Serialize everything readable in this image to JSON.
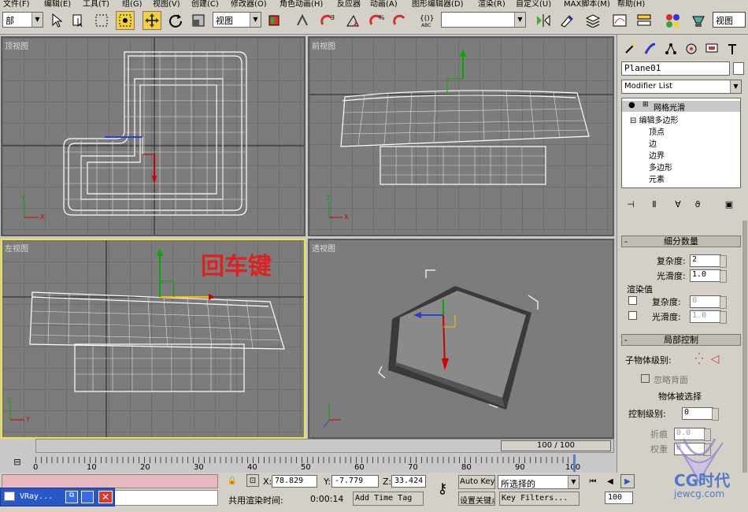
{
  "menu": {
    "items": [
      "文件(F)",
      "编辑(E)",
      "工具(T)",
      "组(G)",
      "视图(V)",
      "创建(C)",
      "修改器(O)",
      "角色动画(H)",
      "反应器",
      "动画(A)",
      "图形编辑器(D)",
      "渲染(R)",
      "自定义(U)",
      "MAX脚本(M)",
      "帮助(H)"
    ]
  },
  "toolbar": {
    "selection_filter": "部",
    "coord_system": "视图",
    "named_selection": "",
    "right_label": "视图",
    "icons": [
      "select-arrow",
      "select-by-name",
      "rect-region",
      "window-crossing",
      "move",
      "rotate",
      "scale",
      "snap",
      "angle-snap",
      "percent-snap",
      "spinner-snap",
      "edit-named-sel",
      "mirror",
      "align",
      "layers",
      "curve-editor",
      "schematic",
      "material-editor",
      "render-scene",
      "quick-render"
    ]
  },
  "viewports": {
    "top": {
      "label": "顶视图"
    },
    "front": {
      "label": "前视图"
    },
    "left": {
      "label": "左视图",
      "annotation": "回车键"
    },
    "perspective": {
      "label": "透视图"
    }
  },
  "axis_labels": {
    "x": "X",
    "y": "Y",
    "z": "Z"
  },
  "timeline": {
    "frame_counter": "100 / 100",
    "ticks": [
      "0",
      "10",
      "20",
      "30",
      "40",
      "50",
      "60",
      "70",
      "80",
      "90",
      "100"
    ]
  },
  "panel": {
    "object_name": "Plane01",
    "modifier_list": "Modifier List",
    "stack": {
      "item1": "网格光滑",
      "item2": "编辑多边形",
      "sub": [
        "顶点",
        "边",
        "边界",
        "多边形",
        "元素"
      ]
    },
    "subdiv": {
      "header": "细分数量",
      "iterations_label": "复杂度:",
      "iterations_value": "2",
      "smoothness_label": "光滑度:",
      "smoothness_value": "1.0",
      "render_label": "渲染值",
      "r_iter_label": "复杂度:",
      "r_iter_value": "0",
      "r_smooth_label": "光滑度:",
      "r_smooth_value": "1.0"
    },
    "local": {
      "header": "局部控制",
      "sublevel_label": "子物体级别:",
      "ignore_backface": "忽略背面",
      "selected": "物体被选择",
      "control_level_label": "控制级别:",
      "control_level_value": "0",
      "crease_label": "折痕",
      "crease_value": "0.0",
      "weight_label": "权重",
      "weight_value": "0"
    }
  },
  "status": {
    "taskbar_label": "VRay...",
    "x_label": "X:",
    "x_value": "78.829",
    "y_label": "Y:",
    "y_value": "-7.779",
    "z_label": "Z:",
    "z_value": "33.424",
    "render_time_label": "共用渲染时间:",
    "render_time_value": "0:00:14",
    "add_time_tag": "Add Time Tag",
    "auto_key": "Auto Key",
    "set_key": "设置关键点",
    "key_mode": "所选择的",
    "key_filters": "Key Filters...",
    "frame_field": "100",
    "watermark1": "CG时代",
    "watermark2": "jewcg.com"
  },
  "colors": {
    "active_border": "#f2e24a",
    "viewport_bg": "#7c7c7c",
    "annotation": "#e02020"
  }
}
